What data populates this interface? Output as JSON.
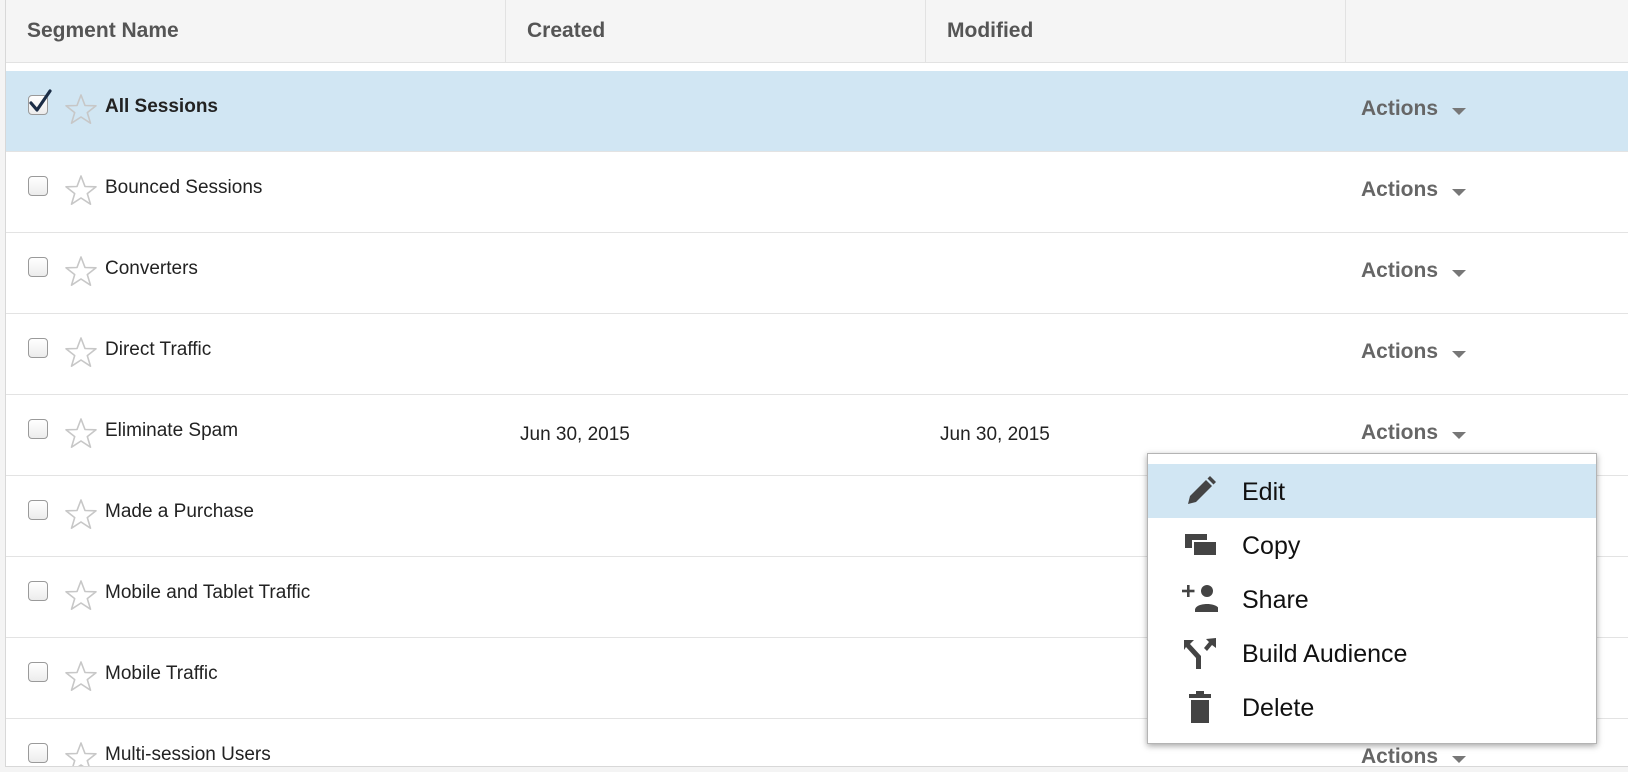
{
  "table": {
    "columns": [
      "Segment Name",
      "Created",
      "Modified",
      ""
    ],
    "rows": [
      {
        "name": "All Sessions",
        "created": "",
        "modified": "",
        "actions": "Actions",
        "checked": true,
        "selected": true
      },
      {
        "name": "Bounced Sessions",
        "created": "",
        "modified": "",
        "actions": "Actions",
        "checked": false,
        "selected": false
      },
      {
        "name": "Converters",
        "created": "",
        "modified": "",
        "actions": "Actions",
        "checked": false,
        "selected": false
      },
      {
        "name": "Direct Traffic",
        "created": "",
        "modified": "",
        "actions": "Actions",
        "checked": false,
        "selected": false
      },
      {
        "name": "Eliminate Spam",
        "created": "Jun 30, 2015",
        "modified": "Jun 30, 2015",
        "actions": "Actions",
        "checked": false,
        "selected": false
      },
      {
        "name": "Made a Purchase",
        "created": "",
        "modified": "",
        "actions": "",
        "checked": false,
        "selected": false
      },
      {
        "name": "Mobile and Tablet Traffic",
        "created": "",
        "modified": "",
        "actions": "",
        "checked": false,
        "selected": false
      },
      {
        "name": "Mobile Traffic",
        "created": "",
        "modified": "",
        "actions": "",
        "checked": false,
        "selected": false
      },
      {
        "name": "Multi-session Users",
        "created": "",
        "modified": "",
        "actions": "Actions",
        "checked": false,
        "selected": false
      }
    ]
  },
  "actions_menu": {
    "items": [
      {
        "label": "Edit",
        "icon": "pencil-icon",
        "active": true
      },
      {
        "label": "Copy",
        "icon": "copy-icon",
        "active": false
      },
      {
        "label": "Share",
        "icon": "add-person-icon",
        "active": false
      },
      {
        "label": "Build Audience",
        "icon": "merge-arrows-icon",
        "active": false
      },
      {
        "label": "Delete",
        "icon": "trash-icon",
        "active": false
      }
    ]
  },
  "colors": {
    "selected_row": "#d1e6f3",
    "header_bg": "#f5f5f5",
    "actions_text": "#666666",
    "icon": "#444444"
  }
}
